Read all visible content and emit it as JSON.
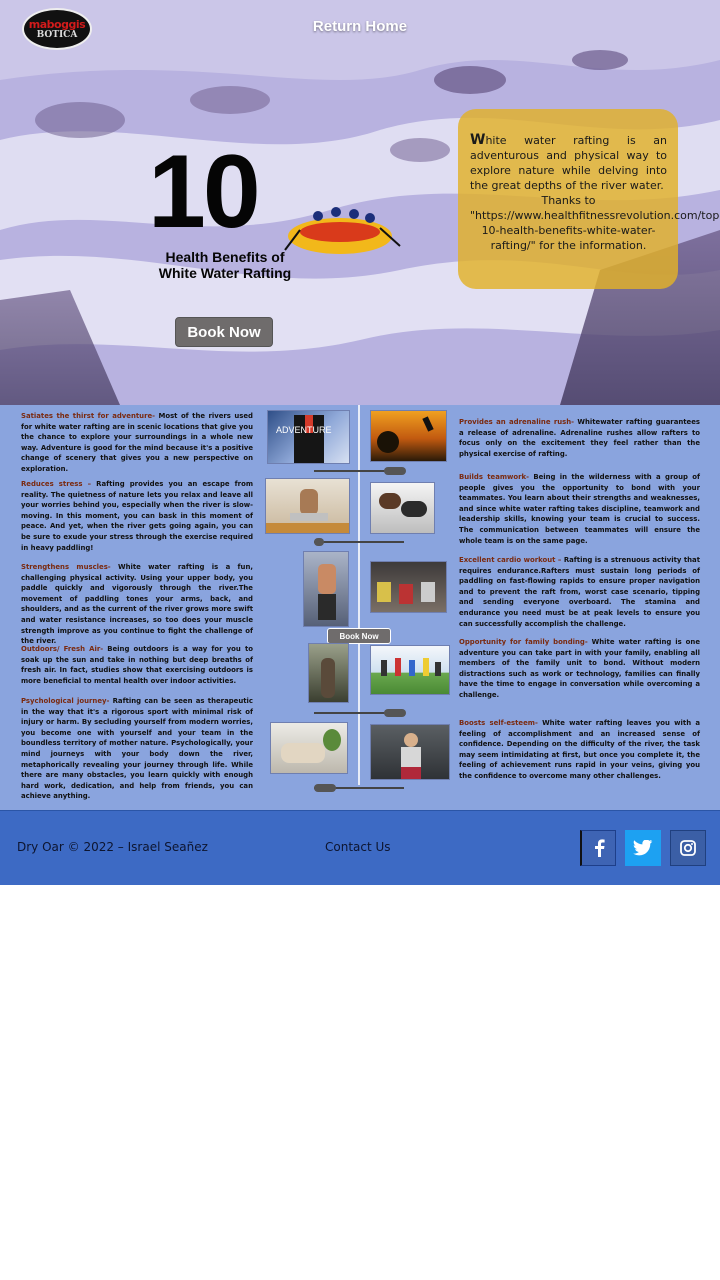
{
  "nav": {
    "logo_line1": "maboggis",
    "logo_line2": "BOTICA",
    "return_home": "Return Home"
  },
  "hero": {
    "number": "10",
    "headline_line1": "Health Benefits of",
    "headline_line2": "White Water Rafting",
    "book_now": "Book Now",
    "intro_first_letter": "W",
    "intro_text": "hite water rafting is an adventurous and physical way to explore nature while delving into the great depths of the river water.",
    "thanks": "Thanks to",
    "source": "\"https://www.healthfitnessrevolution.com/top-10-health-benefits-white-water-rafting/\" for the information."
  },
  "benefits_left": [
    {
      "title": "Satiates the thirst for adventure-",
      "text": " Most of the rivers used for white water rafting are in scenic locations that give you the chance to explore your surroundings in a whole new way. Adventure is good for the mind because it's a positive change of scenery that gives you a new perspective on exploration."
    },
    {
      "title": "Reduces stress –",
      "text": " Rafting provides you an escape from reality. The quietness of nature lets you relax and leave all your worries behind you, especially when the river is slow-moving. In this moment, you can bask in this moment of peace. And yet, when the river gets going again, you can be sure to exude your stress through the exercise required in heavy paddling!"
    },
    {
      "title": "Strengthens muscles-",
      "text": " White water rafting is a fun, challenging physical activity. Using your upper body, you paddle quickly and vigorously through the river.The movement of paddling tones your arms, back, and shoulders, and as the current of the river grows more swift and water resistance increases, so too does your muscle strength improve as you continue to fight the challenge of the river."
    },
    {
      "title": "Outdoors/ Fresh Air-",
      "text": " Being outdoors is a way for you to soak up the sun and take in nothing but deep breaths of fresh air. In fact, studies show that exercising outdoors is more beneficial to mental health over indoor activities."
    },
    {
      "title": "Psychological journey-",
      "text": " Rafting can be seen as therapeutic in the way that it's a rigorous sport with minimal risk of injury or harm. By secluding yourself from modern worries, you become one with yourself and your team in the boundless territory of mother nature. Psychologically, your mind journeys with your body down the river, metaphorically revealing your journey through life. While there are many obstacles, you learn quickly with enough hard work, dedication, and help from friends, you can achieve anything."
    }
  ],
  "benefits_right": [
    {
      "title": "Provides an adrenaline rush-",
      "text": " Whitewater rafting guarantees a release of adrenaline. Adrenaline rushes allow rafters to focus only on the excitement they feel rather than the physical exercise of rafting."
    },
    {
      "title": "Builds teamwork-",
      "text": " Being in the wilderness with a group of people gives you the opportunity to bond with your teammates. You learn about their strengths and weaknesses, and since white water rafting takes discipline, teamwork and leadership skills, knowing your team is crucial to success. The communication between teammates will ensure the whole team is on the same page."
    },
    {
      "title": "Excellent cardio workout –",
      "text": " Rafting is a strenuous activity that requires endurance.Rafters must sustain long periods of paddling on fast-flowing rapids to ensure proper navigation and to prevent the raft from, worst case scenario, tipping and sending everyone overboard. The stamina and endurance you need must be at peak levels to ensure you can successfully accomplish the challenge."
    },
    {
      "title": "Opportunity for family bonding-",
      "text": " White water rafting is one adventure you can take part in with your family, enabling all members of the family unit to bond. Without modern distractions such as work or technology, families can finally have the time to engage in conversation while overcoming a challenge."
    },
    {
      "title": "Boosts self-esteem-",
      "text": " White water rafting leaves you with a feeling of accomplishment and an increased sense of confidence. Depending on the difficulty of the river, the task may seem intimidating at first, but once you complete it, the feeling of achievement runs rapid in your veins, giving you the confidence to overcome many other challenges."
    }
  ],
  "timeline": {
    "adventure_label": "ADVENTURE",
    "book_now": "Book Now"
  },
  "footer": {
    "copyright": "Dry Oar © 2022 – Israel Seañez",
    "contact": "Contact Us"
  },
  "icons": {
    "facebook": "facebook-icon",
    "twitter": "twitter-icon",
    "instagram": "instagram-icon"
  },
  "colors": {
    "content_bg": "#8aa4de",
    "footer_bg": "#3d6ac4",
    "card_bg": "#e2b128",
    "heading_accent": "#7a2a10"
  }
}
